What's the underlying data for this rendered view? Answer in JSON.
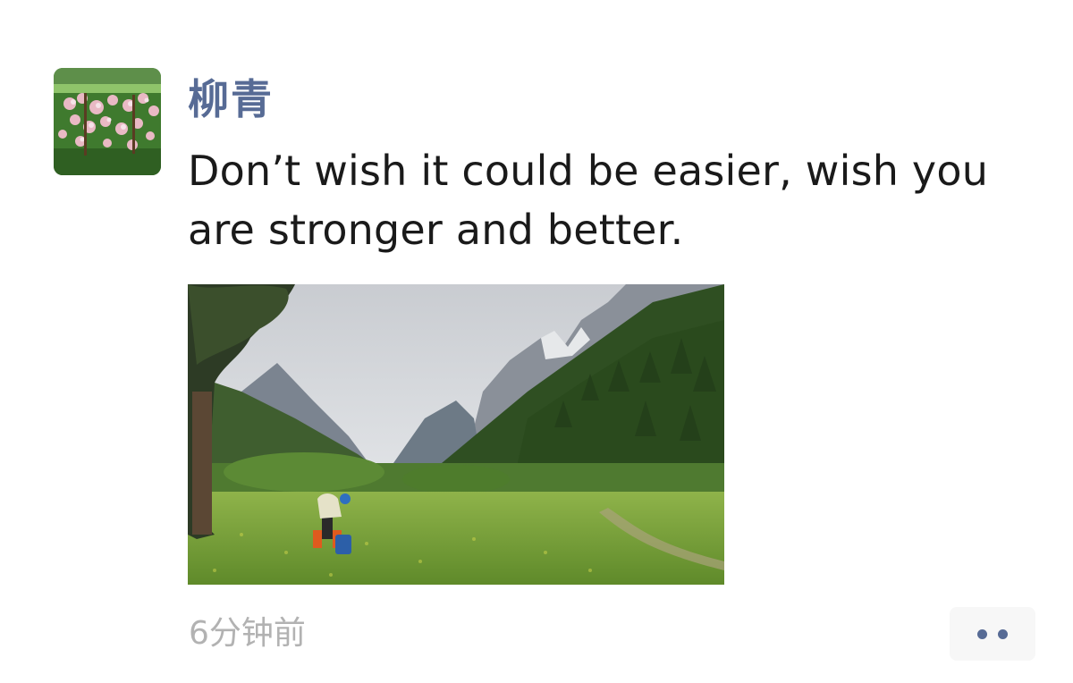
{
  "post": {
    "username": "柳青",
    "text": "Don’t wish it could be easier, wish you are stronger and better.",
    "timestamp": "6分钟前"
  },
  "avatar": {
    "subject": "pink blossoms over green lawn"
  },
  "photo": {
    "subject": "mountain valley meadow with hiker and backpack"
  },
  "icons": {
    "more": "more-dots-icon"
  },
  "colors": {
    "username": "#576b95",
    "timestamp": "#b2b2b2",
    "more_button_bg": "#f7f7f7"
  }
}
